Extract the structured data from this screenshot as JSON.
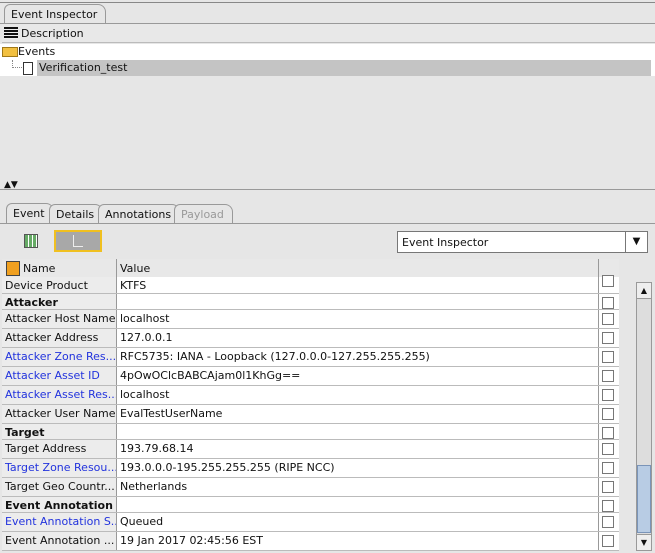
{
  "window_tab": "Event Inspector",
  "tree": {
    "header": "Description",
    "root": "Events",
    "child": "Verification_test"
  },
  "tabs": [
    {
      "label": "Event"
    },
    {
      "label": "Details"
    },
    {
      "label": "Annotations"
    },
    {
      "label": "Payload",
      "disabled": true
    }
  ],
  "view_select": "Event Inspector",
  "table": {
    "columns": [
      "Name",
      "Value"
    ],
    "rows": [
      {
        "name": "Device Product",
        "value": "KTFS",
        "type": "normal"
      },
      {
        "name": "Attacker",
        "value": "",
        "type": "group"
      },
      {
        "name": "Attacker Host Name",
        "value": "localhost",
        "type": "normal"
      },
      {
        "name": "Attacker Address",
        "value": "127.0.0.1",
        "type": "normal"
      },
      {
        "name": "Attacker Zone Res...",
        "value": "RFC5735: IANA - Loopback (127.0.0.0-127.255.255.255)",
        "type": "link"
      },
      {
        "name": "Attacker Asset ID",
        "value": "4pOwOClcBABCAjam0l1KhGg==",
        "type": "link"
      },
      {
        "name": "Attacker Asset Res...",
        "value": "localhost",
        "type": "link"
      },
      {
        "name": "Attacker User Name",
        "value": "EvalTestUserName",
        "type": "normal"
      },
      {
        "name": "Target",
        "value": "",
        "type": "group"
      },
      {
        "name": "Target Address",
        "value": "193.79.68.14",
        "type": "normal"
      },
      {
        "name": "Target Zone Resou...",
        "value": "193.0.0.0-195.255.255.255 (RIPE NCC)",
        "type": "link"
      },
      {
        "name": "Target Geo Countr...",
        "value": "Netherlands",
        "type": "normal"
      },
      {
        "name": "Event Annotation",
        "value": "",
        "type": "group"
      },
      {
        "name": "Event Annotation S...",
        "value": "Queued",
        "type": "link"
      },
      {
        "name": "Event Annotation ...",
        "value": "19 Jan 2017 02:45:56 EST",
        "type": "normal"
      }
    ]
  }
}
